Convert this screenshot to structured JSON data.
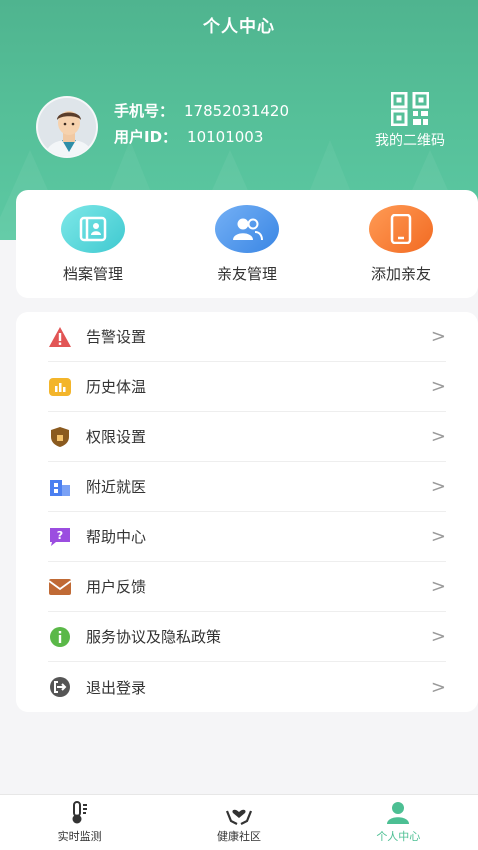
{
  "header": {
    "title": "个人中心",
    "phone_label": "手机号：",
    "phone_value": "17852031420",
    "userid_label": "用户ID：",
    "userid_value": "10101003",
    "qr_label": "我的二维码"
  },
  "quick_actions": [
    {
      "label": "档案管理",
      "icon": "archive-icon"
    },
    {
      "label": "亲友管理",
      "icon": "users-icon"
    },
    {
      "label": "添加亲友",
      "icon": "phone-icon"
    }
  ],
  "menu": [
    {
      "label": "告警设置",
      "icon": "warning-icon",
      "color": "#e25555"
    },
    {
      "label": "历史体温",
      "icon": "chart-icon",
      "color": "#f3b52b"
    },
    {
      "label": "权限设置",
      "icon": "shield-icon",
      "color": "#8a5a1f"
    },
    {
      "label": "附近就医",
      "icon": "hospital-icon",
      "color": "#4b7ff0"
    },
    {
      "label": "帮助中心",
      "icon": "help-icon",
      "color": "#9b4de0"
    },
    {
      "label": "用户反馈",
      "icon": "mail-icon",
      "color": "#c06a35"
    },
    {
      "label": "服务协议及隐私政策",
      "icon": "info-icon",
      "color": "#5ab848"
    },
    {
      "label": "退出登录",
      "icon": "logout-icon",
      "color": "#555555"
    }
  ],
  "chevron": ">",
  "tabbar": [
    {
      "label": "实时监测",
      "icon": "thermometer-icon"
    },
    {
      "label": "健康社区",
      "icon": "hands-heart-icon"
    },
    {
      "label": "个人中心",
      "icon": "person-icon",
      "active": true
    }
  ],
  "colors": {
    "brand": "#4fb48f",
    "active_tab": "#4cbf93"
  }
}
